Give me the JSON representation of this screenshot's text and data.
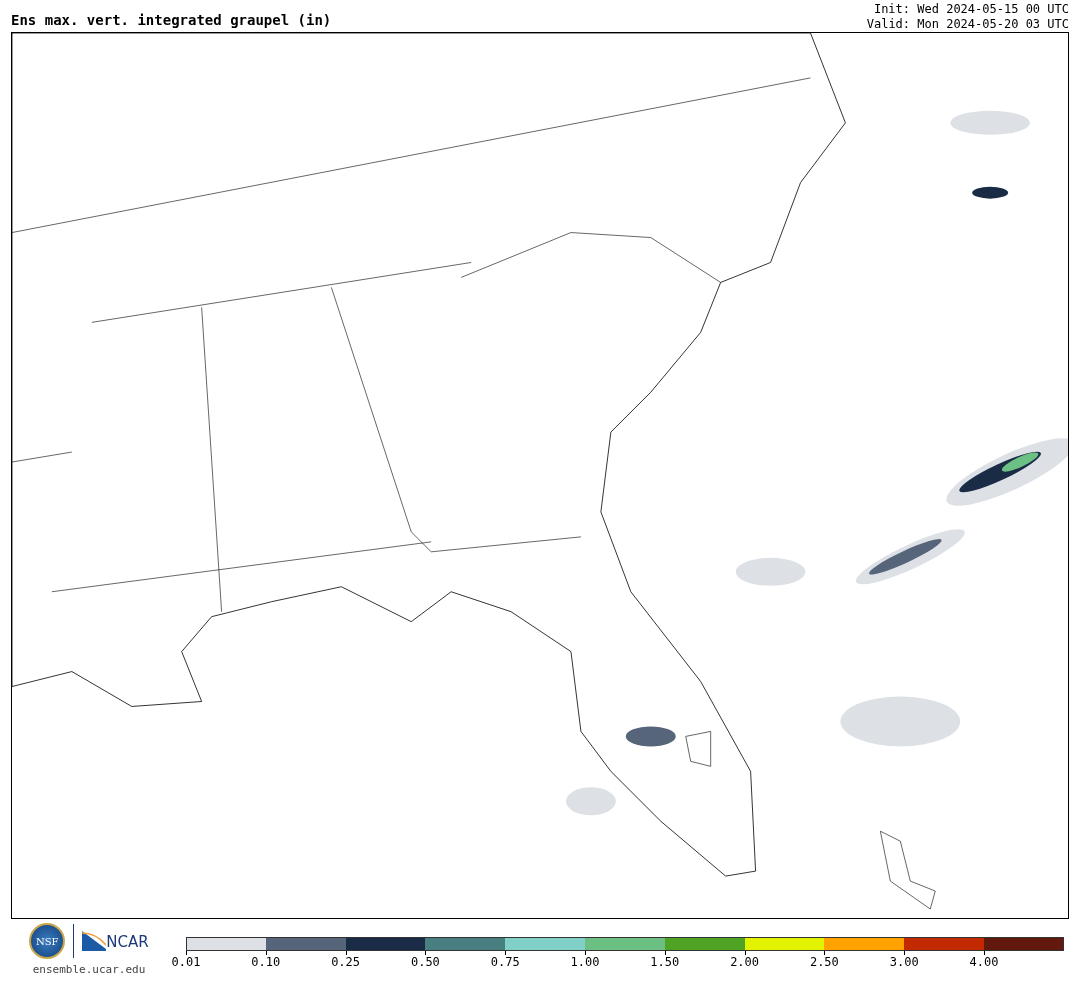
{
  "header": {
    "title": "Ens max. vert. integrated graupel (in)",
    "init": "Init: Wed 2024-05-15 00 UTC",
    "valid": "Valid: Mon 2024-05-20 03 UTC"
  },
  "footer": {
    "logos": [
      "NSF",
      "NCAR"
    ],
    "site": "ensemble.ucar.edu"
  },
  "colorbar": [
    {
      "label": "0.01",
      "color": "#dde1e6"
    },
    {
      "label": "0.10",
      "color": "#56657a"
    },
    {
      "label": "0.25",
      "color": "#1a2b45"
    },
    {
      "label": "0.50",
      "color": "#4a7f82"
    },
    {
      "label": "0.75",
      "color": "#80d0c8"
    },
    {
      "label": "1.00",
      "color": "#6cc083"
    },
    {
      "label": "1.50",
      "color": "#4ea224"
    },
    {
      "label": "2.00",
      "color": "#e2f200"
    },
    {
      "label": "2.50",
      "color": "#ffa200"
    },
    {
      "label": "3.00",
      "color": "#c42a00"
    },
    {
      "label": "4.00",
      "color": "#62190d"
    }
  ]
}
